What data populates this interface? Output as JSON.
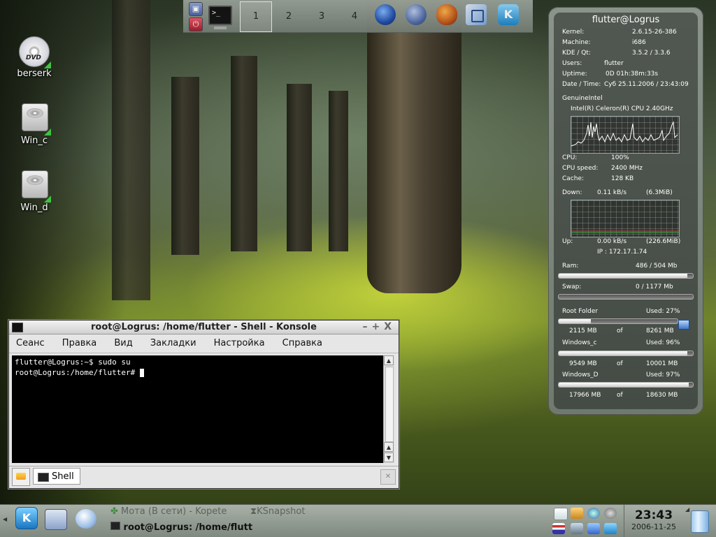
{
  "desktop_icons": [
    {
      "label": "berserk",
      "kind": "dvd",
      "badge": "DVD"
    },
    {
      "label": "Win_c",
      "kind": "hdd"
    },
    {
      "label": "Win_d",
      "kind": "hdd"
    }
  ],
  "top_panel": {
    "desktops": [
      "1",
      "2",
      "3",
      "4"
    ],
    "active_desktop": "1",
    "launchers": [
      "lock-icon",
      "logout-icon",
      "konsole-icon",
      "browser-globe-icon",
      "thunderbird-icon",
      "amarok-icon",
      "network-icon",
      "kde-icon"
    ]
  },
  "widget": {
    "title": "flutter@Logrus",
    "sysinfo": [
      {
        "label": "Kernel:",
        "value": "2.6.15-26-386"
      },
      {
        "label": "Machine:",
        "value": "i686"
      },
      {
        "label": "KDE / Qt:",
        "value": "3.5.2  /  3.3.6"
      },
      {
        "label": "Users:",
        "value": "flutter"
      },
      {
        "label": "Uptime:",
        "value": "0D  01h:38m:33s"
      },
      {
        "label": "Date / Time:",
        "value": "Суб 25.11.2006 / 23:43:09"
      }
    ],
    "cpu_vendor": "GenuineIntel",
    "cpu_model": "Intel(R) Celeron(R) CPU 2.40GHz",
    "cpu": [
      {
        "label": "CPU:",
        "value": "100%"
      },
      {
        "label": "CPU speed:",
        "value": "2400 MHz"
      },
      {
        "label": "Cache:",
        "value": "128 KB"
      }
    ],
    "down": {
      "label": "Down:",
      "rate": "0.11 kB/s",
      "total": "(6.3MiB)"
    },
    "up": {
      "label": "Up:",
      "rate": "0.00 kB/s",
      "total": "(226.6MiB)"
    },
    "ip": "IP :  172.17.1.74",
    "ram": {
      "label": "Ram:",
      "value": "486 / 504 Mb",
      "fraction": 0.96
    },
    "swap": {
      "label": "Swap:",
      "value": "0 / 1177 Mb",
      "fraction": 0.0
    },
    "disks": [
      {
        "name": "Root Folder",
        "used": "Used: 27%",
        "fraction": 0.27,
        "used_mb": "2115 MB",
        "of": "of",
        "total_mb": "8261 MB"
      },
      {
        "name": "Windows_c",
        "used": "Used: 96%",
        "fraction": 0.96,
        "used_mb": "9549 MB",
        "of": "of",
        "total_mb": "10001 MB"
      },
      {
        "name": "Windows_D",
        "used": "Used: 97%",
        "fraction": 0.97,
        "used_mb": "17966 MB",
        "of": "of",
        "total_mb": "18630 MB"
      }
    ]
  },
  "konsole": {
    "title": "root@Logrus: /home/flutter - Shell - Konsole",
    "menu": [
      "Сеанс",
      "Правка",
      "Вид",
      "Закладки",
      "Настройка",
      "Справка"
    ],
    "lines": [
      "flutter@Logrus:~$ sudo su",
      "root@Logrus:/home/flutter# "
    ],
    "tab_label": "Shell"
  },
  "taskbar": {
    "tasks": [
      {
        "label": "Мота (В сети) - Kopete"
      },
      {
        "label": "KSnapshot"
      },
      {
        "label": "root@Logrus: /home/flutt"
      }
    ],
    "clock_time": "23:43",
    "clock_date": "2006-11-25"
  },
  "colors": {
    "cpu_graph": "#ffffff",
    "down_graph_red": "#d04040",
    "down_graph_green": "#40b040",
    "mount_badge": "#3ec43e"
  }
}
